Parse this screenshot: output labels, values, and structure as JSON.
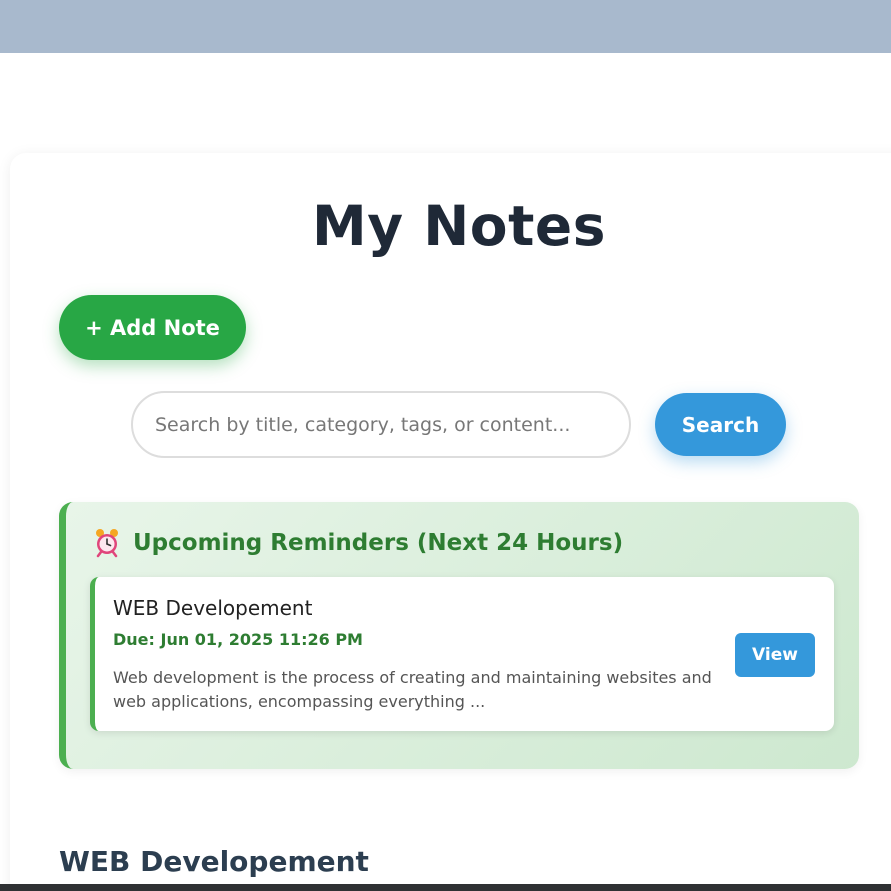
{
  "header": {
    "title": "My Notes"
  },
  "actions": {
    "add_note_label": "+ Add Note"
  },
  "search": {
    "placeholder": "Search by title, category, tags, or content...",
    "button_label": "Search"
  },
  "reminders": {
    "heading": "Upcoming Reminders (Next 24 Hours)",
    "icon": "alarm-clock-icon",
    "items": [
      {
        "title": "WEB Developement",
        "due": "Due: Jun 01, 2025 11:26 PM",
        "preview": "Web development is the process of creating and maintaining websites and web applications, encompassing everything ...",
        "view_label": "View"
      }
    ]
  },
  "notes": [
    {
      "title": "WEB Developement"
    }
  ],
  "colors": {
    "top_band": "#a8b9cd",
    "add_note_green": "#28a745",
    "search_blue": "#3498db",
    "reminder_accent": "#4caf50",
    "reminder_text": "#2e7d32"
  }
}
